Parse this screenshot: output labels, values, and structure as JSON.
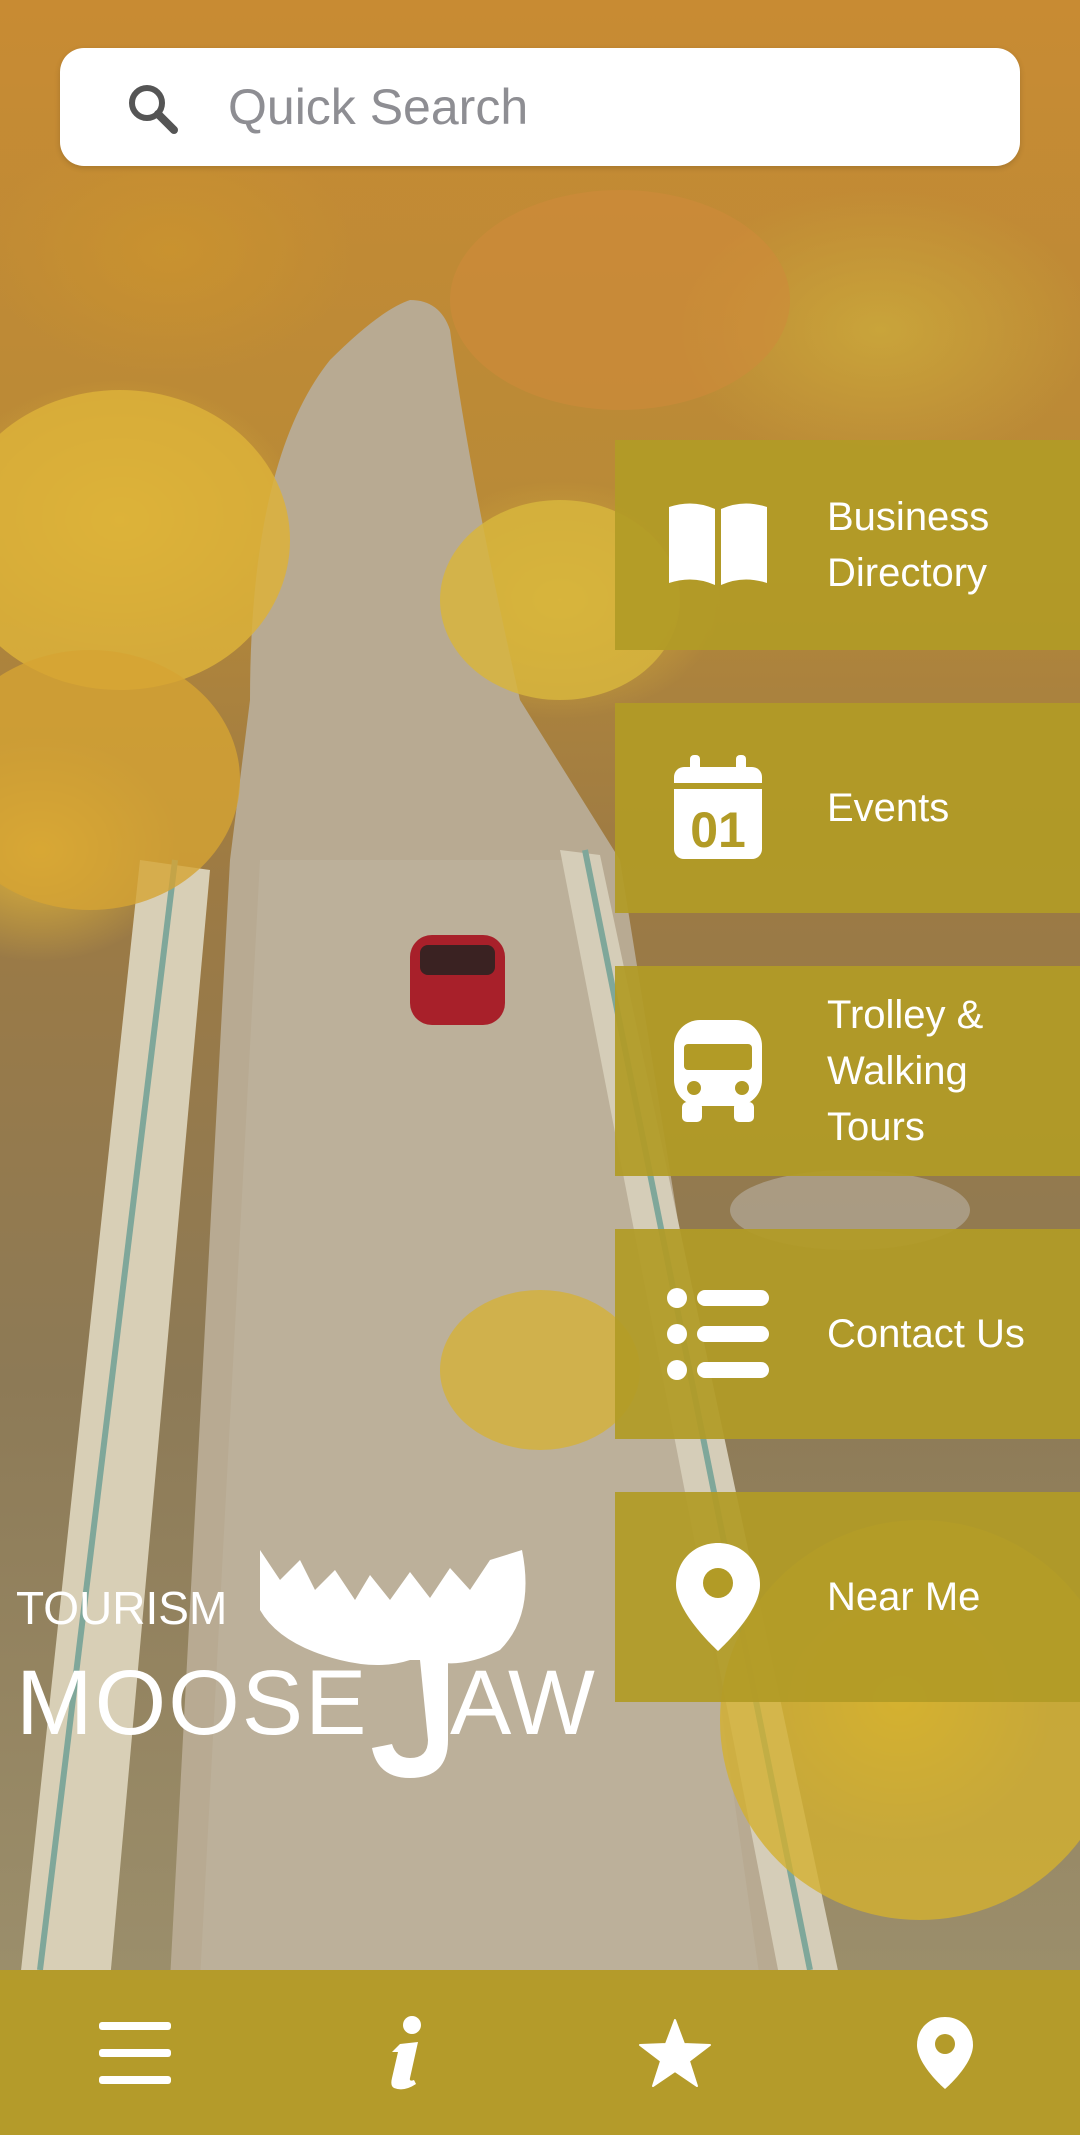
{
  "search": {
    "placeholder": "Quick Search",
    "icon": "search-icon"
  },
  "menu": [
    {
      "label": "Business Directory",
      "icon": "book-icon"
    },
    {
      "label": "Events",
      "icon": "calendar-icon",
      "icon_text": "01"
    },
    {
      "label": "Trolley & Walking Tours",
      "icon": "bus-icon"
    },
    {
      "label": "Contact Us",
      "icon": "list-icon"
    },
    {
      "label": "Near Me",
      "icon": "map-pin-icon"
    }
  ],
  "logo": {
    "line1": "TOURISM",
    "line2": "MOOSE",
    "line3": "AW"
  },
  "bottom_nav": [
    {
      "icon": "hamburger-menu-icon"
    },
    {
      "icon": "info-icon"
    },
    {
      "icon": "star-icon"
    },
    {
      "icon": "location-pin-icon"
    }
  ],
  "colors": {
    "tile": "#b29b26",
    "bottom_bar": "#b49b2a",
    "text": "#ffffff"
  }
}
